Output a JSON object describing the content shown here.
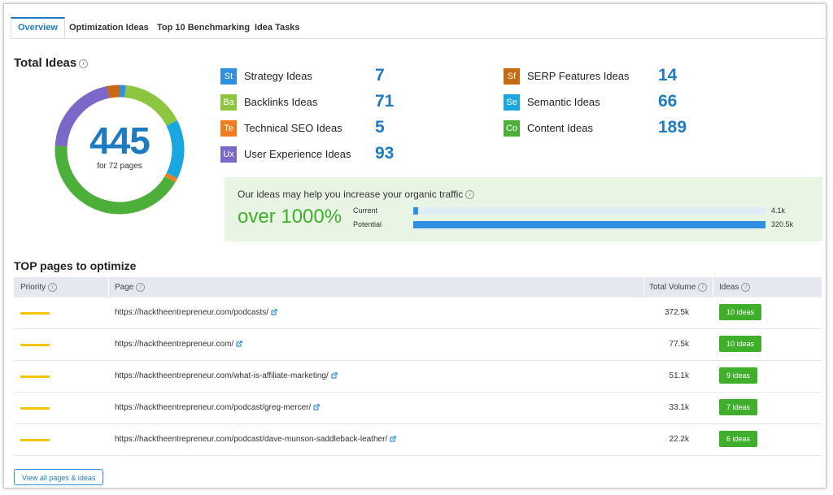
{
  "tabs": [
    {
      "label": "Overview",
      "active": true
    },
    {
      "label": "Optimization Ideas",
      "active": false
    },
    {
      "label": "Top 10 Benchmarking",
      "active": false
    },
    {
      "label": "Idea Tasks",
      "active": false
    }
  ],
  "summary": {
    "title": "Total Ideas",
    "total": "445",
    "subtitle": "for 72 pages"
  },
  "idea_categories": [
    {
      "abbr": "St",
      "label": "Strategy Ideas",
      "count": "7",
      "color": "#2f8fe0"
    },
    {
      "abbr": "Ba",
      "label": "Backlinks Ideas",
      "count": "71",
      "color": "#8cc63f"
    },
    {
      "abbr": "Te",
      "label": "Technical SEO Ideas",
      "count": "5",
      "color": "#f47a20"
    },
    {
      "abbr": "Ux",
      "label": "User Experience Ideas",
      "count": "93",
      "color": "#7b68c8"
    },
    {
      "abbr": "Sf",
      "label": "SERP Features Ideas",
      "count": "14",
      "color": "#c8690f"
    },
    {
      "abbr": "Se",
      "label": "Semantic Ideas",
      "count": "66",
      "color": "#1aa7e0"
    },
    {
      "abbr": "Co",
      "label": "Content Ideas",
      "count": "189",
      "color": "#4caf3a"
    }
  ],
  "donut_order": [
    "St",
    "Ba",
    "Se",
    "Te",
    "Co",
    "Ux",
    "Sf"
  ],
  "traffic": {
    "title": "Our ideas may help you increase your organic traffic",
    "headline": "over 1000%",
    "current_label": "Current",
    "current_value": "4.1k",
    "current_fraction": 0.013,
    "potential_label": "Potential",
    "potential_value": "320.5k",
    "potential_fraction": 1.0
  },
  "top_pages": {
    "title": "TOP pages to optimize",
    "columns": {
      "priority": "Priority",
      "page": "Page",
      "volume": "Total Volume",
      "ideas": "Ideas"
    },
    "rows": [
      {
        "url": "https://hacktheentrepreneur.com/podcasts/",
        "volume": "372.5k",
        "ideas": "10 ideas"
      },
      {
        "url": "https://hacktheentrepreneur.com/",
        "volume": "77.5k",
        "ideas": "10 ideas"
      },
      {
        "url": "https://hacktheentrepreneur.com/what-is-affiliate-marketing/",
        "volume": "51.1k",
        "ideas": "9 ideas"
      },
      {
        "url": "https://hacktheentrepreneur.com/podcast/greg-mercer/",
        "volume": "33.1k",
        "ideas": "7 ideas"
      },
      {
        "url": "https://hacktheentrepreneur.com/podcast/dave-munson-saddleback-leather/",
        "volume": "22.2k",
        "ideas": "6 ideas"
      }
    ],
    "view_all_label": "View all pages & ideas"
  }
}
